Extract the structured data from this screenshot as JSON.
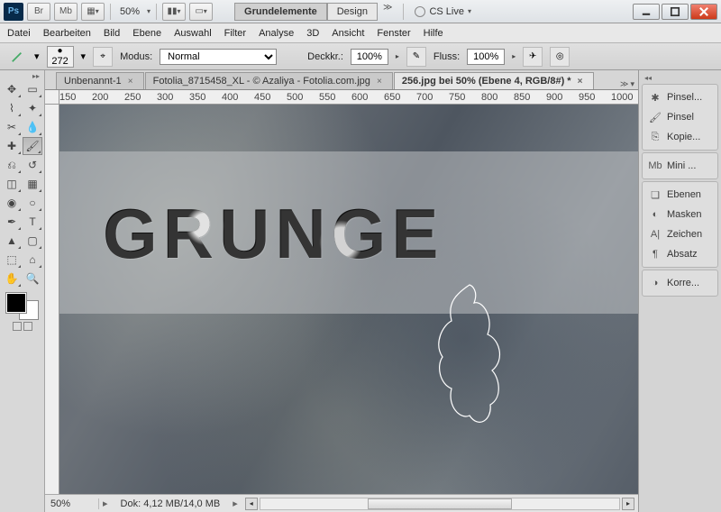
{
  "title": {
    "zoom": "50%",
    "workspace_active": "Grundelemente",
    "workspace_other": "Design",
    "cslive": "CS Live"
  },
  "menu": [
    "Datei",
    "Bearbeiten",
    "Bild",
    "Ebene",
    "Auswahl",
    "Filter",
    "Analyse",
    "3D",
    "Ansicht",
    "Fenster",
    "Hilfe"
  ],
  "options": {
    "brush_size": "272",
    "mode_label": "Modus:",
    "mode_value": "Normal",
    "opacity_label": "Deckkr.:",
    "opacity_value": "100%",
    "flow_label": "Fluss:",
    "flow_value": "100%"
  },
  "tabs": [
    {
      "label": "Unbenannt-1",
      "active": false
    },
    {
      "label": "Fotolia_8715458_XL - © Azaliya - Fotolia.com.jpg",
      "active": false
    },
    {
      "label": "256.jpg bei 50% (Ebene 4, RGB/8#) *",
      "active": true
    }
  ],
  "ruler_ticks": [
    "150",
    "200",
    "250",
    "300",
    "350",
    "400",
    "450",
    "500",
    "550",
    "600",
    "650",
    "700",
    "750",
    "800",
    "850",
    "900",
    "950",
    "1000"
  ],
  "canvas": {
    "text": "GRUNGE"
  },
  "status": {
    "zoom": "50%",
    "dok": "Dok: 4,12 MB/14,0 MB"
  },
  "panels": {
    "g1": [
      "Pinsel...",
      "Pinsel",
      "Kopie..."
    ],
    "g2": [
      "Mini ..."
    ],
    "g3": [
      "Ebenen",
      "Masken",
      "Zeichen",
      "Absatz"
    ],
    "g4": [
      "Korre..."
    ]
  }
}
